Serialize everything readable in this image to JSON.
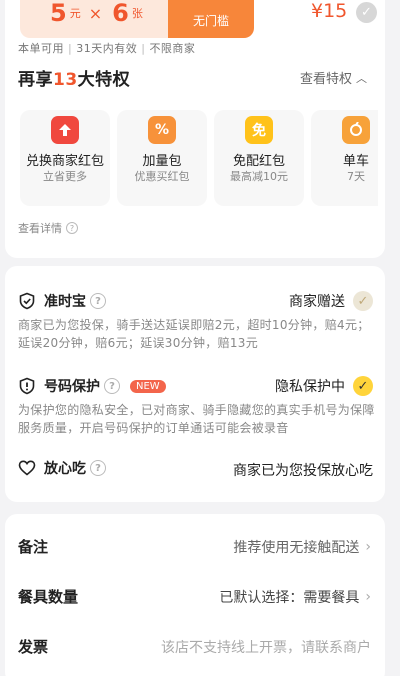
{
  "coupon": {
    "amount": "5",
    "amount_unit": "元",
    "times": "×",
    "count": "6",
    "count_unit": "张",
    "threshold": "无门槛",
    "price": "¥15",
    "desc": [
      "本单可用",
      "31天内有效",
      "不限商家"
    ]
  },
  "privileges": {
    "title_pre": "再享",
    "title_num": "13",
    "title_post": "大特权",
    "view_all": "查看特权",
    "items": [
      {
        "name": "兑换商家红包",
        "sub": "立省更多",
        "icon": "red-arrow-icon",
        "color": "#f0483e"
      },
      {
        "name": "加量包",
        "sub": "优惠买红包",
        "icon": "percent-icon",
        "color": "#f7923a"
      },
      {
        "name": "免配红包",
        "sub": "最高减10元",
        "icon": "free-delivery-icon",
        "color": "#ffc21a"
      },
      {
        "name": "单车",
        "sub": "7天",
        "icon": "bike-icon",
        "color": "#f7a23a"
      }
    ],
    "details": "查看详情"
  },
  "services": {
    "ontime": {
      "title": "准时宝",
      "status": "商家赠送",
      "desc": "商家已为您投保，骑手送达延误即赔2元，超时10分钟，赔4元；延误20分钟，赔6元；延误30分钟，赔13元"
    },
    "privacy": {
      "title": "号码保护",
      "badge": "NEW",
      "status": "隐私保护中",
      "desc": "为保护您的隐私安全，已对商家、骑手隐藏您的真实手机号为保障服务质量，开启号码保护的订单通话可能会被录音"
    },
    "worry_free": {
      "title": "放心吃",
      "status": "商家已为您投保放心吃"
    }
  },
  "form": {
    "remark_label": "备注",
    "remark_value": "推荐使用无接触配送",
    "tableware_label": "餐具数量",
    "tableware_value": "已默认选择：需要餐具",
    "invoice_label": "发票",
    "invoice_value": "该店不支持线上开票，请联系商户"
  }
}
